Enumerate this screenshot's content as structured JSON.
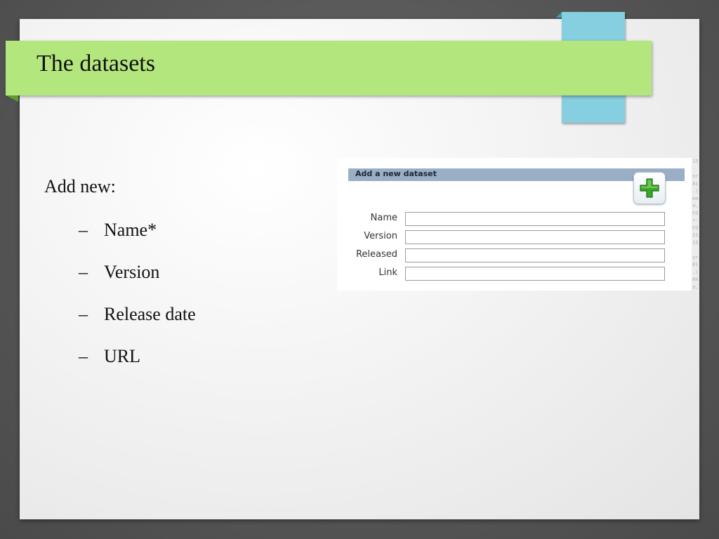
{
  "slide": {
    "title": "The datasets",
    "intro": "Add new:",
    "bullets": [
      "Name*",
      "Version",
      "Release date",
      "URL"
    ],
    "bullet_marker": "–"
  },
  "form": {
    "header": "Add a new dataset",
    "add_icon": "plus-icon",
    "fields": [
      {
        "label": "Name",
        "value": ""
      },
      {
        "label": "Version",
        "value": ""
      },
      {
        "label": "Released",
        "value": ""
      },
      {
        "label": "Link",
        "value": ""
      }
    ]
  },
  "code_strip": "15\n \nor\n81\n.(\nem\na,\nFO\n+-\nFO\n11\n15\n \nor\n81\n.(\nem\na,\nFO",
  "colors": {
    "title_band": "#b4e67e",
    "accent_tab": "#86cfe0",
    "form_header": "#9aaec6",
    "plus_green": "#3aa52a"
  }
}
